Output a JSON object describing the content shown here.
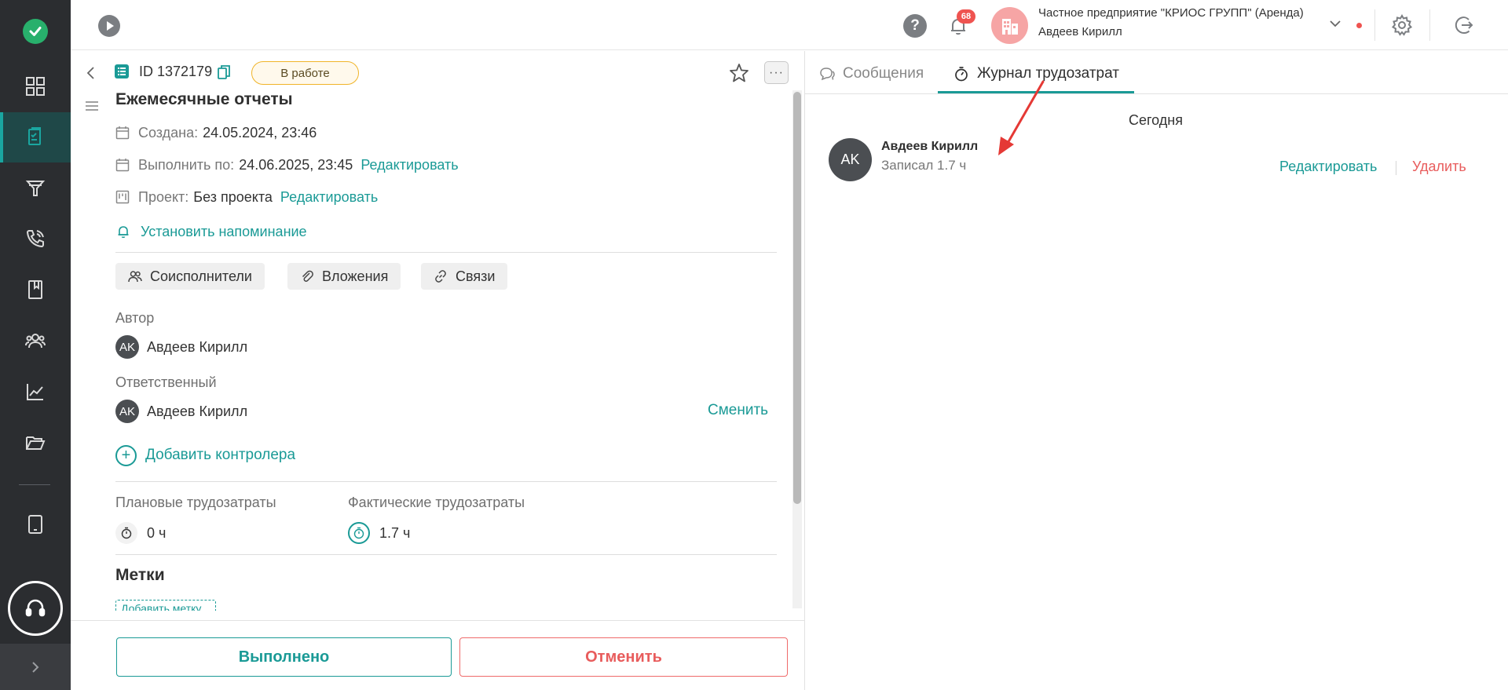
{
  "header": {
    "notification_count": "68",
    "org_name": "Частное предприятие \"КРИОС ГРУПП\" (Аренда)",
    "user_name": "Авдеев Кирилл",
    "help_glyph": "?"
  },
  "rail": {
    "items": [
      "dashboard-icon",
      "tasks-icon",
      "funnel-icon",
      "phone-icon",
      "book-icon",
      "people-icon",
      "chart-icon",
      "folder-icon",
      "tablet-icon"
    ],
    "active": "tasks-icon",
    "accent_color": "#1aa6a0"
  },
  "task": {
    "id_label": "ID 1372179",
    "status": "В работе",
    "title": "Ежемесячные отчеты",
    "created_label": "Создана:",
    "created_value": "24.05.2024, 23:46",
    "due_label": "Выполнить по:",
    "due_value": "24.06.2025, 23:45",
    "due_edit": "Редактировать",
    "project_label": "Проект:",
    "project_value": "Без проекта",
    "project_edit": "Редактировать",
    "reminder": "Установить напоминание",
    "chips": [
      "Соисполнители",
      "Вложения",
      "Связи"
    ],
    "author_label": "Автор",
    "author_initials": "AK",
    "author_name": "Авдеев Кирилл",
    "responsible_label": "Ответственный",
    "responsible_initials": "AK",
    "responsible_name": "Авдеев Кирилл",
    "change": "Сменить",
    "add_controller": "Добавить контролера",
    "planned_label": "Плановые трудозатраты",
    "planned_value": "0 ч",
    "actual_label": "Фактические трудозатраты",
    "actual_value": "1.7 ч",
    "tags_title": "Метки",
    "add_tag": "Добавить метку",
    "done_button": "Выполнено",
    "cancel_button": "Отменить"
  },
  "right": {
    "tab_messages": "Сообщения",
    "tab_journal": "Журнал трудозатрат",
    "day_label": "Сегодня",
    "entry": {
      "avatar_initials": "AK",
      "author": "Авдеев Кирилл",
      "text": "Записал 1.7 ч",
      "edit": "Редактировать",
      "delete": "Удалить"
    }
  },
  "colors": {
    "teal": "#1a9a96",
    "danger": "#e85c5c",
    "status_border": "#f0b429",
    "rail_bg": "#2b2d30"
  }
}
